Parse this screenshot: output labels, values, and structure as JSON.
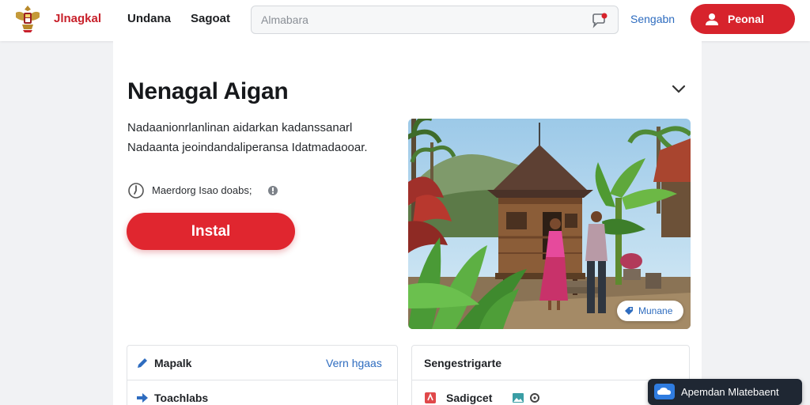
{
  "header": {
    "brand": "Jlnagkal",
    "nav": [
      "Undana",
      "Sagoat"
    ],
    "search_placeholder": "Almabara",
    "link": "Sengabn",
    "profile_button": "Peonal"
  },
  "main": {
    "title": "Nenagal Aigan",
    "description": [
      "Nadaanionrlanlinan aidarkan kadanssanarl",
      "Nadaanta jeoindandaliperansa Idatmadaooar."
    ],
    "meta_text": "Maerdorg Isao doabs;",
    "install_button": "Instal",
    "photo_badge": "Munane"
  },
  "panels": {
    "left": {
      "rows": [
        {
          "label": "Mapalk",
          "link": "Vern hgaas"
        },
        {
          "label": "Toachlabs"
        }
      ]
    },
    "right": {
      "rows": [
        {
          "label": "Sengestrigarte"
        },
        {
          "label": "Sadigcet"
        }
      ]
    }
  },
  "toast": {
    "label": "Apemdan Mlatebaent"
  },
  "colors": {
    "accent_red": "#d7232c",
    "link_blue": "#2e6cbf",
    "toast_bg": "#1f2733"
  }
}
